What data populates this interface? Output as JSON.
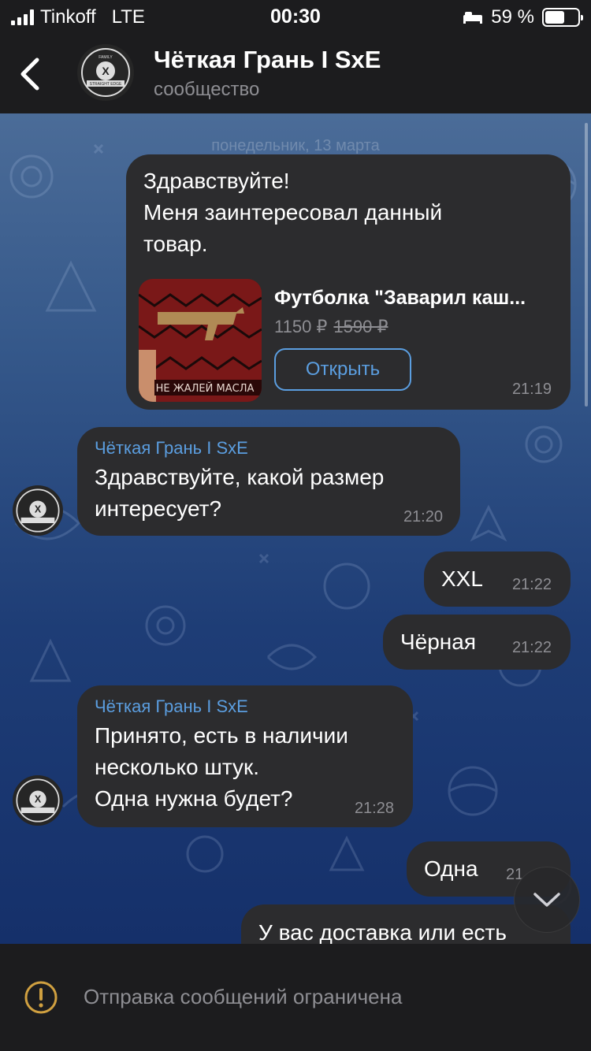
{
  "status_bar": {
    "carrier": "Tinkoff",
    "network": "LTE",
    "time": "00:30",
    "battery_percent": "59 %",
    "battery_level": 0.59,
    "icons": [
      "signal-icon",
      "bed-icon",
      "battery-icon"
    ]
  },
  "header": {
    "title": "Чёткая Грань I SxE",
    "subtitle": "сообщество",
    "back_icon": "chevron-left-icon"
  },
  "chat": {
    "date_label": "понедельник, 13 марта",
    "messages": [
      {
        "direction": "out",
        "text": "Здравствуйте!\nМеня заинтересовал данный\nтовар.",
        "time": "21:19",
        "product": {
          "title": "Футболка \"Заварил каш...",
          "price": "1150 ₽",
          "old_price": "1590 ₽",
          "button": "Открыть"
        }
      },
      {
        "direction": "in",
        "sender": "Чёткая Грань I SxE",
        "text": "Здравствуйте, какой размер\nинтересует?",
        "time": "21:20"
      },
      {
        "direction": "out",
        "text": "XXL",
        "time": "21:22"
      },
      {
        "direction": "out",
        "text": "Чёрная",
        "time": "21:22"
      },
      {
        "direction": "in",
        "sender": "Чёткая Грань I SxE",
        "text": "Принято, есть в наличии\nнесколько штук.\nОдна нужна будет?",
        "time": "21:28"
      },
      {
        "direction": "out",
        "text": "Одна",
        "time": "21"
      },
      {
        "direction": "out",
        "text": "У вас доставка или есть"
      }
    ],
    "scroll_down_icon": "chevron-down-icon"
  },
  "bottom_bar": {
    "icon": "warning-icon",
    "text": "Отправка сообщений ограничена"
  },
  "colors": {
    "accent": "#5b9ee0",
    "bubble": "#2c2c2e",
    "warning": "#d0a040"
  }
}
